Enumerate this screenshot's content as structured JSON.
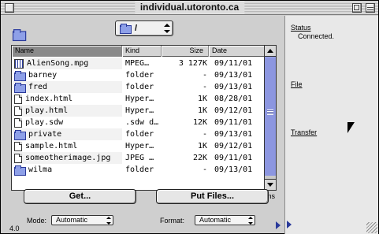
{
  "window": {
    "title": "individual.utoronto.ca"
  },
  "path": {
    "current": "/"
  },
  "columns": {
    "name": "Name",
    "kind": "Kind",
    "size": "Size",
    "date": "Date"
  },
  "files": [
    {
      "icon": "movie-icon",
      "name": "AlienSong.mpg",
      "kind": "MPEG…",
      "size": "3 127K",
      "date": "09/11/01"
    },
    {
      "icon": "folder-icon",
      "name": "barney",
      "kind": "folder",
      "size": "-",
      "date": "09/13/01"
    },
    {
      "icon": "folder-icon",
      "name": "fred",
      "kind": "folder",
      "size": "-",
      "date": "09/13/01"
    },
    {
      "icon": "doc-icon",
      "name": "index.html",
      "kind": "Hyper…",
      "size": "1K",
      "date": "08/28/01"
    },
    {
      "icon": "doc-icon",
      "name": "play.html",
      "kind": "Hyper…",
      "size": "1K",
      "date": "09/12/01"
    },
    {
      "icon": "doc-icon",
      "name": "play.sdw",
      "kind": ".sdw d…",
      "size": "12K",
      "date": "09/11/01"
    },
    {
      "icon": "folder-icon",
      "name": "private",
      "kind": "folder",
      "size": "-",
      "date": "09/13/01"
    },
    {
      "icon": "doc-icon",
      "name": "sample.html",
      "kind": "Hyper…",
      "size": "1K",
      "date": "09/12/01"
    },
    {
      "icon": "doc-icon",
      "name": "someotherimage.jpg",
      "kind": "JPEG …",
      "size": "22K",
      "date": "09/11/01"
    },
    {
      "icon": "folder-icon",
      "name": "wilma",
      "kind": "folder",
      "size": "-",
      "date": "09/13/01"
    }
  ],
  "item_count": "11 items",
  "buttons": {
    "get": "Get...",
    "put": "Put Files..."
  },
  "version": "4.0",
  "mode": {
    "label": "Mode:",
    "value": "Automatic"
  },
  "format": {
    "label": "Format:",
    "value": "Automatic"
  },
  "side": {
    "status_head": "Status",
    "status_text": "Connected.",
    "file_head": "File",
    "transfer_head": "Transfer"
  },
  "colors": {
    "accent": "#8ea0e8",
    "scroll": "#9aa4e8"
  }
}
